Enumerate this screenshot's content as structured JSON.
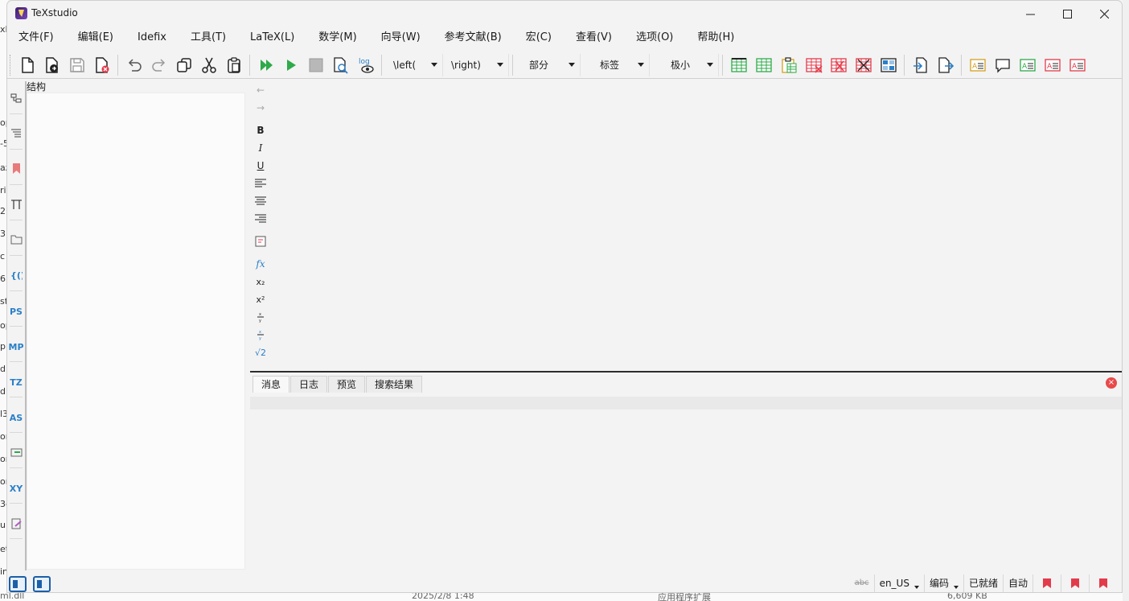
{
  "window": {
    "title": "TeXstudio"
  },
  "background": {
    "left_fragments": [
      "xl",
      "op",
      "-5",
      "az",
      "ri",
      "2",
      "3",
      "c",
      "6",
      "st",
      "op",
      "p",
      "d.",
      "dl",
      "l3",
      "or",
      "or",
      "or",
      "3c",
      "ui",
      "et",
      "in"
    ],
    "bottom": {
      "file": "ml.dll",
      "date": "2025/2/8 1:48",
      "type": "应用程序扩展",
      "size": "6,609 KB"
    }
  },
  "menu": [
    "文件(F)",
    "编辑(E)",
    "Idefix",
    "工具(T)",
    "LaTeX(L)",
    "数学(M)",
    "向导(W)",
    "参考文献(B)",
    "宏(C)",
    "查看(V)",
    "选项(O)",
    "帮助(H)"
  ],
  "toolbar": {
    "left_combo": "\\left(",
    "right_combo": "\\right)",
    "section_combo": "部分",
    "label_combo": "标签",
    "size_combo": "极小",
    "log_label": "log"
  },
  "structure": {
    "title": "结构"
  },
  "side_labels": {
    "ps": "PS",
    "mp": "MP",
    "tz": "TZ",
    "as": "AS",
    "xy": "XY"
  },
  "format_bar": {
    "bold": "B",
    "italic": "I",
    "underline": "U",
    "fx": "fx",
    "sub": "x₂",
    "sup": "x²",
    "sqrt": "√2"
  },
  "messages": {
    "tabs": [
      "消息",
      "日志",
      "预览",
      "搜索结果"
    ]
  },
  "statusbar": {
    "language": "en_US",
    "encoding": "编码",
    "status": "已就绪",
    "auto": "自动"
  },
  "colors": {
    "accent": "#2a7fc8",
    "bookmark": "#e23b4b",
    "run_green": "#2eaa4a"
  }
}
